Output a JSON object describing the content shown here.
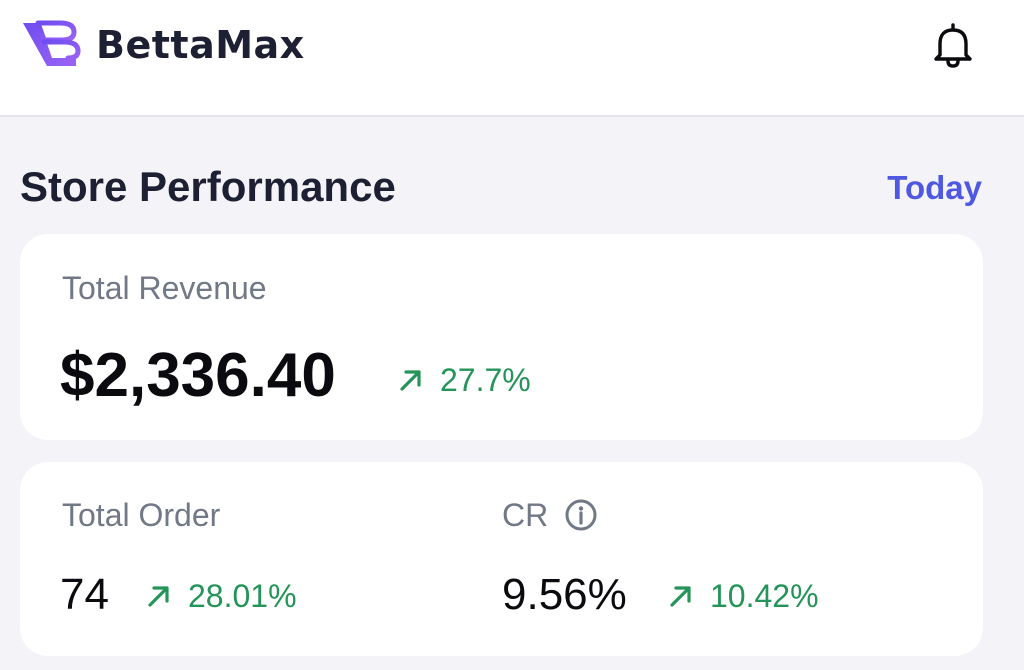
{
  "header": {
    "brand_name": "BettaMax",
    "logo_icon": "bettamax-logo-icon",
    "notification_icon": "bell-icon"
  },
  "section": {
    "title": "Store Performance",
    "period": "Today"
  },
  "revenue": {
    "label": "Total Revenue",
    "value": "$2,336.40",
    "change": "27.7%",
    "trend": "up"
  },
  "total_order": {
    "label": "Total Order",
    "value": "74",
    "change": "28.01%",
    "trend": "up"
  },
  "conversion_rate": {
    "label": "CR",
    "value": "9.56%",
    "change": "10.42%",
    "trend": "up",
    "info_icon": "info-icon"
  },
  "colors": {
    "brand_accent": "#4f58e0",
    "logo_purple": "#7b55f0",
    "positive": "#249458",
    "background": "#f3f3f8",
    "card": "#ffffff",
    "text_primary": "#1d2032",
    "text_muted": "#717886"
  }
}
